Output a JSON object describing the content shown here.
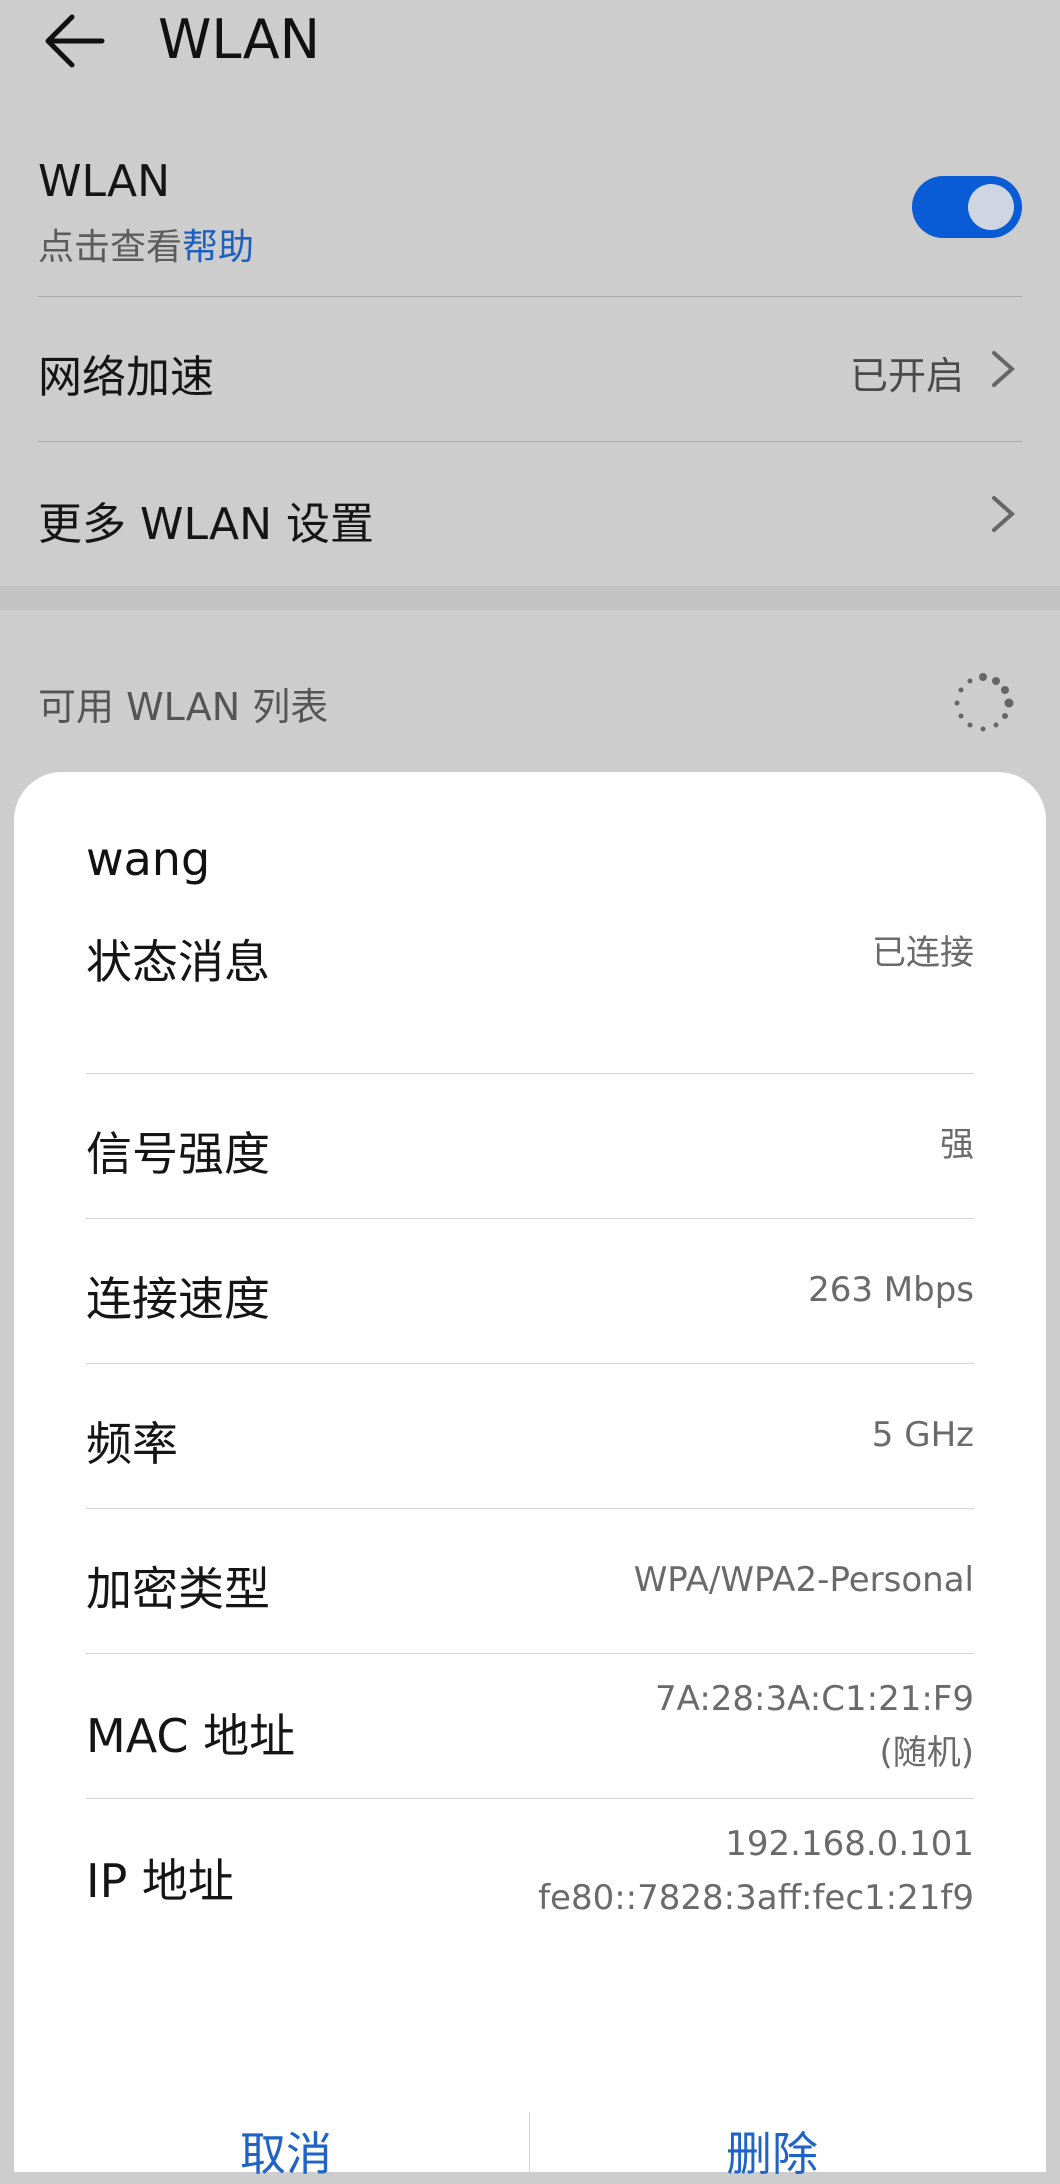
{
  "header": {
    "title": "WLAN"
  },
  "wlan": {
    "label": "WLAN",
    "sub_prefix": "点击查看",
    "sub_link": "帮助",
    "enabled": true
  },
  "accel": {
    "label": "网络加速",
    "value": "已开启"
  },
  "more": {
    "label": "更多 WLAN 设置"
  },
  "list": {
    "title": "可用 WLAN 列表"
  },
  "dialog": {
    "title": "wang",
    "rows": [
      {
        "key": "状态消息",
        "value": "已连接"
      },
      {
        "key": "信号强度",
        "value": "强"
      },
      {
        "key": "连接速度",
        "value": "263 Mbps"
      },
      {
        "key": "频率",
        "value": "5 GHz"
      },
      {
        "key": "加密类型",
        "value": "WPA/WPA2-Personal"
      },
      {
        "key": "MAC 地址",
        "value": "7A:28:3A:C1:21:F9",
        "value2": "(随机)"
      },
      {
        "key": "IP 地址",
        "value": "192.168.0.101",
        "value2": "fe80::7828:3aff:fec1:21f9"
      }
    ],
    "cancel_label": "取消",
    "delete_label": "删除"
  },
  "colors": {
    "accent": "#0a5bd6",
    "link": "#1f5fbf"
  }
}
